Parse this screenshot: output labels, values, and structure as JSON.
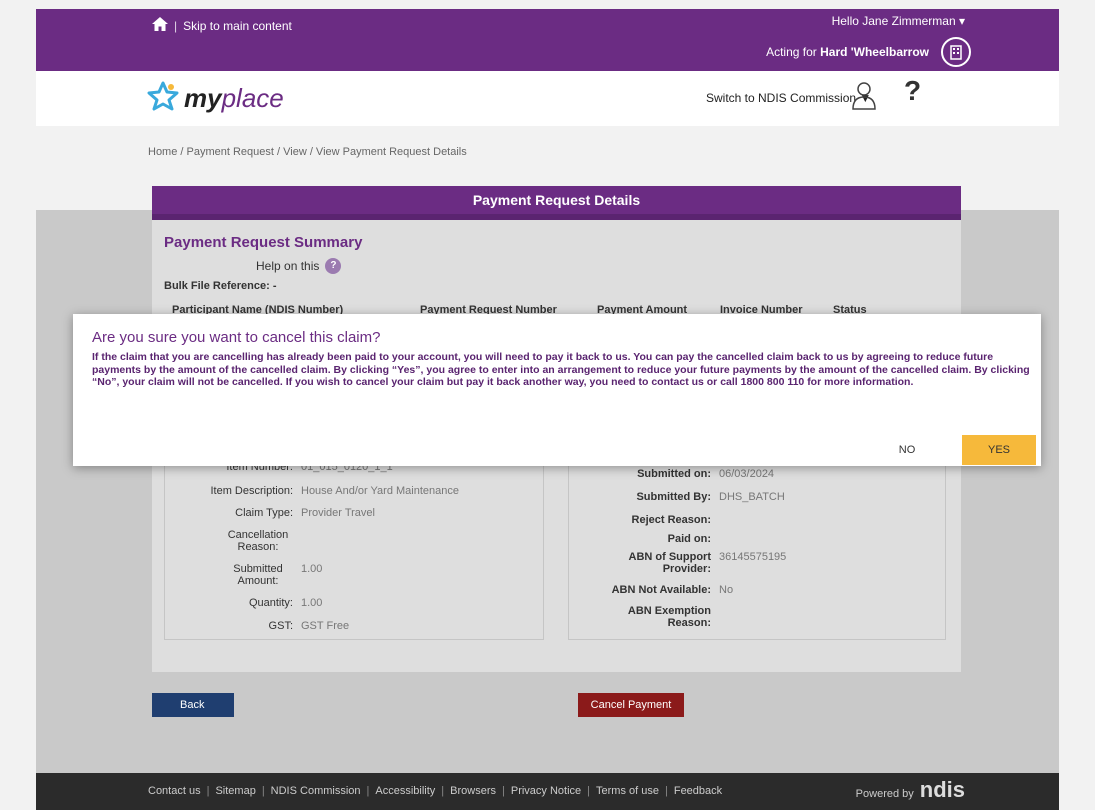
{
  "topbar": {
    "skip_label": "Skip to main content",
    "hello": "Hello Jane Zimmerman",
    "acting_prefix": "Acting for ",
    "acting_name": "Hard 'Wheelbarrow"
  },
  "header": {
    "logo_my": "my",
    "logo_place": "place",
    "switch_label": "Switch to NDIS Commission",
    "help_label": "?"
  },
  "breadcrumb": "Home /  Payment Request  /  View  /  View Payment Request Details",
  "card": {
    "title": "Payment Request Details",
    "summary_title": "Payment Request Summary",
    "help_on": "Help on this",
    "bulk_ref": "Bulk File Reference: -",
    "columns": [
      "Participant Name (NDIS Number)",
      "Payment Request Number",
      "Payment Amount",
      "Invoice Number",
      "Status"
    ]
  },
  "left_details": [
    {
      "label": "Item Number:",
      "value": "01_015_0120_1_1"
    },
    {
      "label": "Item Description:",
      "value": "House And/or Yard Maintenance"
    },
    {
      "label": "Claim Type:",
      "value": "Provider Travel"
    },
    {
      "label": "Cancellation Reason:",
      "value": ""
    },
    {
      "label": "Submitted Amount:",
      "value": "1.00"
    },
    {
      "label": "Quantity:",
      "value": "1.00"
    },
    {
      "label": "GST:",
      "value": "GST Free"
    }
  ],
  "right_details": [
    {
      "label": "Submitted on:",
      "value": "06/03/2024"
    },
    {
      "label": "Submitted By:",
      "value": "DHS_BATCH"
    },
    {
      "label": "Reject Reason:",
      "value": ""
    },
    {
      "label": "Paid on:",
      "value": ""
    },
    {
      "label": "ABN of Support Provider:",
      "value": "36145575195"
    },
    {
      "label": "ABN Not Available:",
      "value": "No"
    },
    {
      "label": "ABN Exemption Reason:",
      "value": ""
    }
  ],
  "buttons": {
    "back": "Back",
    "cancel_payment": "Cancel Payment"
  },
  "modal": {
    "title": "Are you sure you want to cancel this claim?",
    "text": "If the claim that you are cancelling has already been paid to your account, you will need to pay it back to us. You can pay the cancelled claim back to us by agreeing to reduce future payments by the amount of the cancelled claim. By clicking “Yes”, you agree to enter into an arrangement to reduce your future payments by the amount of the cancelled claim. By clicking “No”, your claim will not be cancelled. If you wish to cancel your claim but pay it back another way, you need to contact us or call 1800 800 110 for more information.",
    "no": "NO",
    "yes": "YES"
  },
  "footer": {
    "links": [
      "Contact us",
      "Sitemap",
      "NDIS Commission",
      "Accessibility",
      "Browsers",
      "Privacy Notice",
      "Terms of use",
      "Feedback"
    ],
    "powered_by": "Powered by",
    "brand": "ndis"
  },
  "colors": {
    "brand_purple": "#6b2c83",
    "back_button": "#1f3e70",
    "cancel_button": "#8b1a1a",
    "yes_button": "#f6b93b"
  }
}
